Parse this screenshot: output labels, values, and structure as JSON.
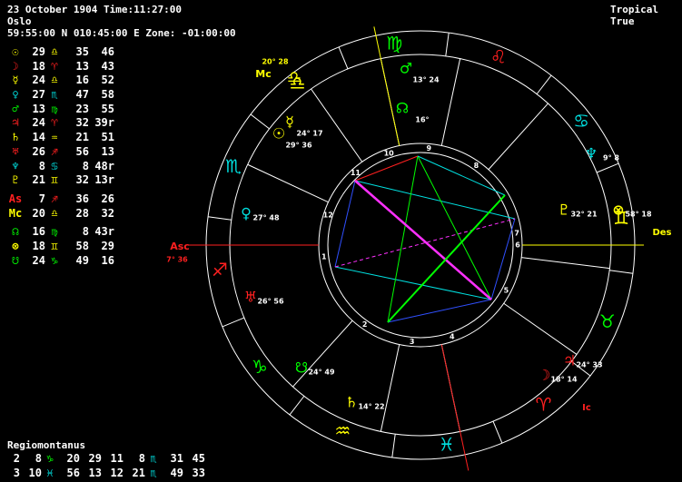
{
  "header": {
    "line1": "23 October 1904 Time:11:27:00",
    "line2": "Oslo",
    "line3": "59:55:00 N 010:45:00 E Zone: -01:00:00",
    "mode": "Tropical True"
  },
  "planets": [
    {
      "glyph": "☉",
      "deg": "29",
      "sign": "♎",
      "min": "35",
      "extra": "46",
      "color": "#ffff00",
      "sign_color": "#ffff00"
    },
    {
      "glyph": "☽",
      "deg": "18",
      "sign": "♈",
      "min": "13",
      "extra": "43",
      "color": "#ff2020",
      "sign_color": "#ff2020"
    },
    {
      "glyph": "☿",
      "deg": "24",
      "sign": "♎",
      "min": "16",
      "extra": "52",
      "color": "#ffff00",
      "sign_color": "#ffff00"
    },
    {
      "glyph": "♀",
      "deg": "27",
      "sign": "♏",
      "min": "47",
      "extra": "58",
      "color": "#00e0e0",
      "sign_color": "#00e0e0"
    },
    {
      "glyph": "♂",
      "deg": "13",
      "sign": "♍",
      "min": "23",
      "extra": "55",
      "color": "#00ff00",
      "sign_color": "#00ff00"
    },
    {
      "glyph": "♃",
      "deg": "24",
      "sign": "♈",
      "min": "32",
      "extra": "39r",
      "color": "#ff2020",
      "sign_color": "#ff2020"
    },
    {
      "glyph": "♄",
      "deg": "14",
      "sign": "♒",
      "min": "21",
      "extra": "51",
      "color": "#ffff00",
      "sign_color": "#ffff00"
    },
    {
      "glyph": "♅",
      "deg": "26",
      "sign": "♐",
      "min": "56",
      "extra": "13",
      "color": "#ff2020",
      "sign_color": "#ff2020"
    },
    {
      "glyph": "♆",
      "deg": "8",
      "sign": "♋",
      "min": "8",
      "extra": "48r",
      "color": "#00e0e0",
      "sign_color": "#00e0e0"
    },
    {
      "glyph": "♇",
      "deg": "21",
      "sign": "♊",
      "min": "32",
      "extra": "13r",
      "color": "#ffff00",
      "sign_color": "#ffff00"
    }
  ],
  "points": [
    {
      "glyph": "As",
      "deg": "7",
      "sign": "♐",
      "min": "36",
      "extra": "26",
      "color": "#ff2020",
      "sign_color": "#ff2020"
    },
    {
      "glyph": "Mc",
      "deg": "20",
      "sign": "♎",
      "min": "28",
      "extra": "32",
      "color": "#ffff00",
      "sign_color": "#ffff00"
    }
  ],
  "nodes": [
    {
      "glyph": "☊",
      "deg": "16",
      "sign": "♍",
      "min": "8",
      "extra": "43r",
      "color": "#00ff00",
      "sign_color": "#00ff00"
    },
    {
      "glyph": "⊗",
      "deg": "18",
      "sign": "♊",
      "min": "58",
      "extra": "29",
      "color": "#ffff00",
      "sign_color": "#ffff00"
    },
    {
      "glyph": "☋",
      "deg": "24",
      "sign": "♑",
      "min": "49",
      "extra": "16",
      "color": "#00ff00",
      "sign_color": "#00ff00"
    }
  ],
  "houses": {
    "system": "Regiomontanus",
    "rows": [
      {
        "a_num": "2",
        "a_deg": "8",
        "a_sign": "♑",
        "a_min": "20",
        "b_num": "29",
        "b_deg": "11",
        "c_num": "8",
        "c_sign": "♏",
        "c_deg": "31",
        "c_min": "45",
        "a_color": "#00ff00",
        "c_color": "#00e0e0"
      },
      {
        "a_num": "3",
        "a_deg": "10",
        "a_sign": "♓",
        "a_min": "56",
        "b_num": "13",
        "b_deg": "12",
        "c_num": "21",
        "c_sign": "♏",
        "c_deg": "49",
        "c_min": "33",
        "a_color": "#00e0e0",
        "c_color": "#00e0e0"
      }
    ]
  },
  "wheel": {
    "zodiac": [
      {
        "sign": "♌",
        "color": "#ff2020"
      },
      {
        "sign": "♍",
        "color": "#00ff00"
      },
      {
        "sign": "♎",
        "color": "#ffff00"
      },
      {
        "sign": "♏",
        "color": "#00e0e0"
      },
      {
        "sign": "♐",
        "color": "#ff2020"
      },
      {
        "sign": "♑",
        "color": "#00ff00"
      },
      {
        "sign": "♒",
        "color": "#ffff00"
      },
      {
        "sign": "♓",
        "color": "#00e0e0"
      },
      {
        "sign": "♈",
        "color": "#ff2020"
      },
      {
        "sign": "♉",
        "color": "#00ff00"
      },
      {
        "sign": "♊",
        "color": "#ffff00"
      },
      {
        "sign": "♋",
        "color": "#00e0e0"
      }
    ],
    "angles": {
      "asc_label": "Asc",
      "asc_deg": "7",
      "asc_min": "36",
      "mc_label": "Mc",
      "mc_deg": "20",
      "mc_min": "28",
      "des_label": "Des",
      "ic_label": "Ic"
    },
    "house_numbers": [
      "1",
      "2",
      "3",
      "4",
      "5",
      "6",
      "7",
      "8",
      "9",
      "10",
      "11",
      "12"
    ],
    "wheel_planets": [
      {
        "glyph": "♂",
        "deg": "13",
        "min": "24",
        "color": "#00ff00"
      },
      {
        "glyph": "☊",
        "deg": "16",
        "min": "",
        "color": "#00ff00"
      },
      {
        "glyph": "☿",
        "deg": "24",
        "min": "17",
        "color": "#ffff00"
      },
      {
        "glyph": "☉",
        "deg": "29",
        "min": "36",
        "color": "#ffff00"
      },
      {
        "glyph": "♆",
        "deg": "9",
        "min": "8",
        "color": "#00e0e0"
      },
      {
        "glyph": "♇",
        "deg": "32",
        "min": "21",
        "color": "#ffff00"
      },
      {
        "glyph": "⊗",
        "deg": "58",
        "min": "18",
        "color": "#ffff00"
      },
      {
        "glyph": "♀",
        "deg": "27",
        "min": "48",
        "color": "#00e0e0"
      },
      {
        "glyph": "♅",
        "deg": "26",
        "min": "56",
        "color": "#ff2020"
      },
      {
        "glyph": "☋",
        "deg": "24",
        "min": "49",
        "color": "#00ff00"
      },
      {
        "glyph": "♄",
        "deg": "14",
        "min": "22",
        "color": "#ffff00"
      },
      {
        "glyph": "♃",
        "deg": "24",
        "min": "33",
        "color": "#ff2020"
      },
      {
        "glyph": "☽",
        "deg": "18",
        "min": "14",
        "color": "#ff2020"
      }
    ]
  }
}
